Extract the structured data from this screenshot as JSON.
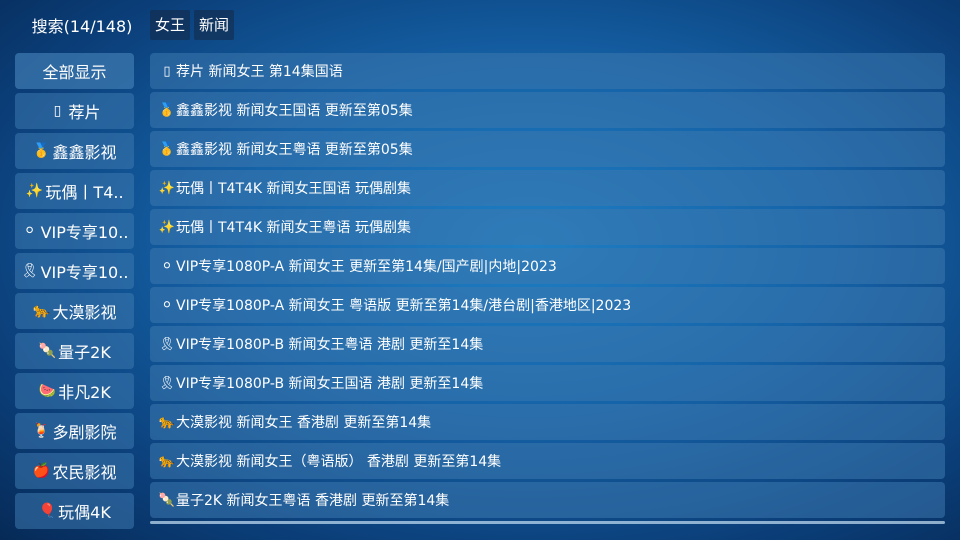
{
  "header": {
    "search_title": "搜索(14/148)",
    "keywords": [
      "女王",
      "新闻"
    ]
  },
  "sidebar": {
    "items": [
      {
        "icon": "",
        "icon_name": "",
        "label": "全部显示"
      },
      {
        "icon": "▯",
        "icon_name": "missing-glyph-icon",
        "label": "荐片"
      },
      {
        "icon": "🥇",
        "icon_name": "gold-medal-icon",
        "label": "鑫鑫影视"
      },
      {
        "icon": "✨",
        "icon_name": "sparkles-icon",
        "label": "玩偶丨T4.."
      },
      {
        "icon": "⚪",
        "icon_name": "white-orb-icon",
        "label": "VIP专享10.."
      },
      {
        "icon": "🎗",
        "icon_name": "yellow-ribbon-icon",
        "label": "VIP专享10.."
      },
      {
        "icon": "🐆",
        "icon_name": "leopard-icon",
        "label": "大漠影视"
      },
      {
        "icon": "🍡",
        "icon_name": "dango-icon",
        "label": "量子2K"
      },
      {
        "icon": "🍉",
        "icon_name": "watermelon-icon",
        "label": "非凡2K"
      },
      {
        "icon": "🍹",
        "icon_name": "drink-icon",
        "label": "多剧影院"
      },
      {
        "icon": "🍎",
        "icon_name": "apple-icon",
        "label": "农民影视"
      },
      {
        "icon": "🎈",
        "icon_name": "balloon-icon",
        "label": "玩偶4K"
      }
    ]
  },
  "results": [
    {
      "icon": "▯",
      "icon_name": "missing-glyph-icon",
      "text": "荐片  新闻女王  第14集国语"
    },
    {
      "icon": "🥇",
      "icon_name": "gold-medal-icon",
      "text": "鑫鑫影视  新闻女王国语  更新至第05集"
    },
    {
      "icon": "🥇",
      "icon_name": "gold-medal-icon",
      "text": "鑫鑫影视  新闻女王粤语  更新至第05集"
    },
    {
      "icon": "✨",
      "icon_name": "sparkles-icon",
      "text": "玩偶丨T4T4K  新闻女王国语   玩偶剧集"
    },
    {
      "icon": "✨",
      "icon_name": "sparkles-icon",
      "text": "玩偶丨T4T4K  新闻女王粤语   玩偶剧集"
    },
    {
      "icon": "⚪",
      "icon_name": "white-orb-icon",
      "text": "VIP专享1080P-A  新闻女王  更新至第14集/国产剧|内地|2023"
    },
    {
      "icon": "⚪",
      "icon_name": "white-orb-icon",
      "text": "VIP专享1080P-A  新闻女王 粤语版  更新至第14集/港台剧|香港地区|2023"
    },
    {
      "icon": "🎗",
      "icon_name": "yellow-ribbon-icon",
      "text": "VIP专享1080P-B  新闻女王粤语 港剧 更新至14集"
    },
    {
      "icon": "🎗",
      "icon_name": "yellow-ribbon-icon",
      "text": "VIP专享1080P-B  新闻女王国语 港剧 更新至14集"
    },
    {
      "icon": "🐆",
      "icon_name": "leopard-icon",
      "text": "大漠影视  新闻女王 香港剧 更新至第14集"
    },
    {
      "icon": "🐆",
      "icon_name": "leopard-icon",
      "text": "大漠影视  新闻女王（粤语版） 香港剧 更新至第14集"
    },
    {
      "icon": "🍡",
      "icon_name": "dango-icon",
      "text": "量子2K  新闻女王粤语 香港剧 更新至第14集"
    }
  ]
}
